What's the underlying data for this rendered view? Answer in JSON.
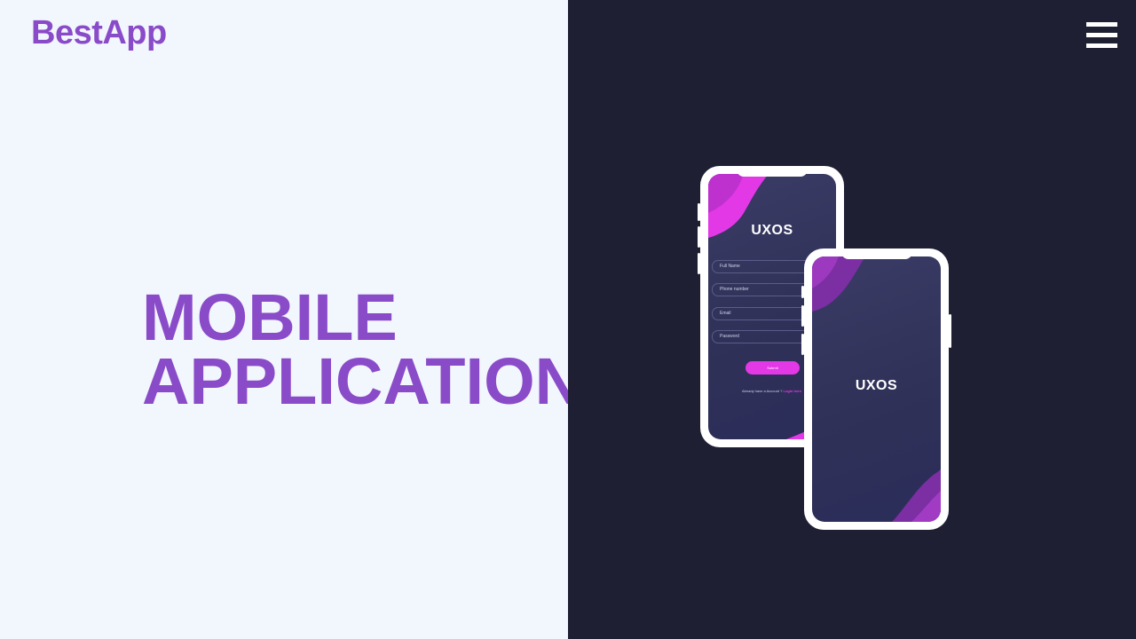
{
  "header": {
    "logo": "BestApp"
  },
  "hero": {
    "line1": "MOBILE",
    "line2": "APPLICATION"
  },
  "menu": {
    "icon": "hamburger-menu-icon"
  },
  "mockup": {
    "brand": "UXOS",
    "fields": [
      "Full Name",
      "Phone number",
      "Email",
      "Password"
    ],
    "submit_label": "Submit",
    "account_text": "Already have a Account ?",
    "account_link": "Login here"
  },
  "colors": {
    "accent": "#8a4bc9",
    "magenta": "#e238e6",
    "dark_bg": "#1f1f34",
    "light_bg": "#f2f6fd"
  }
}
